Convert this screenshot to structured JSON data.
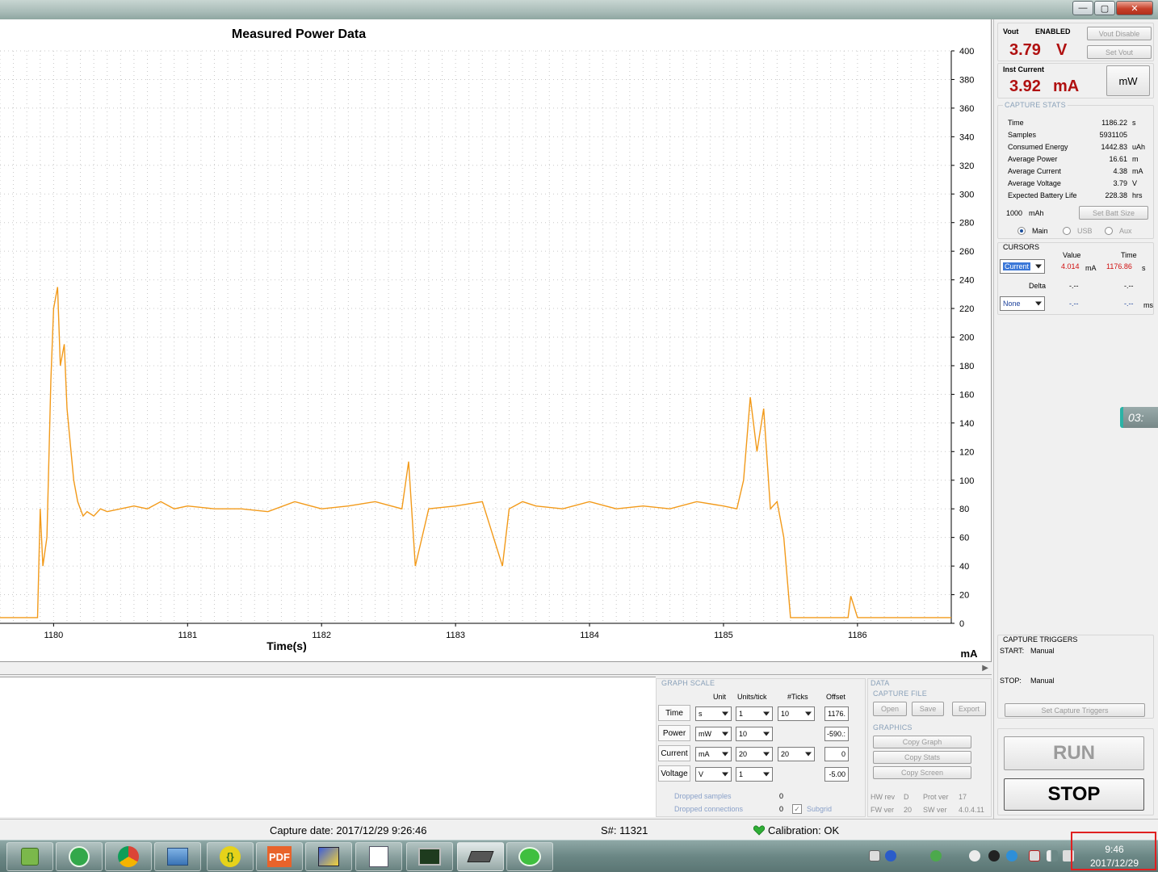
{
  "window": {
    "buttons": {
      "minimize": "—",
      "maximize": "▢",
      "close": "✕"
    }
  },
  "graph": {
    "title": "Measured Power Data",
    "xlabel": "Time(s)",
    "unit_label": "mA"
  },
  "chart_data": {
    "type": "line",
    "title": "Measured Power Data",
    "xlabel": "Time(s)",
    "ylabel": "mA",
    "xlim": [
      1179.6,
      1186.7
    ],
    "ylim": [
      0,
      400
    ],
    "x_ticks": [
      1180,
      1181,
      1182,
      1183,
      1184,
      1185,
      1186
    ],
    "y_ticks": [
      0,
      20,
      40,
      60,
      80,
      100,
      120,
      140,
      160,
      180,
      200,
      220,
      240,
      260,
      280,
      300,
      320,
      340,
      360,
      380,
      400
    ],
    "grid": true,
    "line_color": "#f29a1a",
    "series": [
      {
        "x": [
          1179.6,
          1179.88,
          1179.9,
          1179.92,
          1179.95,
          1179.98,
          1180.0,
          1180.03,
          1180.05,
          1180.08,
          1180.1,
          1180.12,
          1180.15,
          1180.18,
          1180.2,
          1180.22,
          1180.25,
          1180.3,
          1180.35,
          1180.4,
          1180.5,
          1180.6,
          1180.7,
          1180.8,
          1180.9,
          1181.0,
          1181.2,
          1181.4,
          1181.6,
          1181.8,
          1182.0,
          1182.2,
          1182.4,
          1182.6,
          1182.65,
          1182.7,
          1182.8,
          1183.0,
          1183.2,
          1183.35,
          1183.4,
          1183.5,
          1183.6,
          1183.8,
          1184.0,
          1184.2,
          1184.4,
          1184.6,
          1184.8,
          1185.0,
          1185.1,
          1185.15,
          1185.2,
          1185.25,
          1185.3,
          1185.35,
          1185.4,
          1185.45,
          1185.5,
          1185.6,
          1185.8,
          1185.93,
          1185.95,
          1186.0,
          1186.2,
          1186.5,
          1186.7
        ],
        "y": [
          4,
          4,
          80,
          40,
          60,
          170,
          220,
          235,
          180,
          195,
          150,
          130,
          100,
          85,
          80,
          75,
          78,
          75,
          80,
          78,
          80,
          82,
          80,
          85,
          80,
          82,
          80,
          80,
          78,
          85,
          80,
          82,
          85,
          80,
          113,
          40,
          80,
          82,
          85,
          40,
          80,
          85,
          82,
          80,
          85,
          80,
          82,
          80,
          85,
          82,
          80,
          100,
          158,
          120,
          150,
          80,
          85,
          60,
          4,
          4,
          4,
          4,
          19,
          4,
          4,
          4,
          4
        ]
      }
    ]
  },
  "right_panel": {
    "vout": {
      "label": "Vout",
      "status": "ENABLED",
      "value": "3.79",
      "unit": "V",
      "disable_btn": "Vout Disable",
      "set_btn": "Set Vout"
    },
    "inst_current": {
      "label": "Inst Current",
      "value": "3.92",
      "unit": "mA",
      "mode_btn": "mW"
    },
    "capture_stats": {
      "title": "CAPTURE STATS",
      "rows": [
        {
          "label": "Time",
          "value": "1186.22",
          "unit": "s"
        },
        {
          "label": "Samples",
          "value": "5931105",
          "unit": ""
        },
        {
          "label": "Consumed Energy",
          "value": "1442.83",
          "unit": "uAh"
        },
        {
          "label": "Average Power",
          "value": "16.61",
          "unit": "m"
        },
        {
          "label": "Average Current",
          "value": "4.38",
          "unit": "mA"
        },
        {
          "label": "Average Voltage",
          "value": "3.79",
          "unit": "V"
        },
        {
          "label": "Expected Battery Life",
          "value": "228.38",
          "unit": "hrs"
        }
      ],
      "battery_size": "1000",
      "battery_unit": "mAh",
      "set_batt_btn": "Set Batt Size",
      "radios": [
        {
          "label": "Main",
          "selected": true
        },
        {
          "label": "USB",
          "selected": false
        },
        {
          "label": "Aux",
          "selected": false
        }
      ]
    },
    "cursors": {
      "title": "CURSORS",
      "col_value": "Value",
      "col_time": "Time",
      "cursor1_select": "Current",
      "cursor1_value": "4.014",
      "cursor1_value_unit": "mA",
      "cursor1_time": "1176.86",
      "cursor1_time_unit": "s",
      "delta_label": "Delta",
      "delta_value": "-.--",
      "delta_time": "-.--",
      "cursor2_select": "None",
      "cursor2_value": "-.--",
      "cursor2_time": "-.--",
      "cursor2_time_unit": "ms"
    },
    "side_tab": "03:",
    "capture_triggers": {
      "title": "CAPTURE TRIGGERS",
      "start_label": "START:",
      "start_value": "Manual",
      "stop_label": "STOP:",
      "stop_value": "Manual",
      "set_btn": "Set Capture Triggers"
    },
    "run_btn": "RUN",
    "stop_btn": "STOP"
  },
  "graph_scale": {
    "title": "GRAPH SCALE",
    "headers": {
      "unit": "Unit",
      "units_tick": "Units/tick",
      "ticks": "#Ticks",
      "offset": "Offset"
    },
    "rows": [
      {
        "name": "Time",
        "unit": "s",
        "per_tick": "1",
        "ticks": "10",
        "offset": "1176."
      },
      {
        "name": "Power",
        "unit": "mW",
        "per_tick": "10",
        "ticks": "",
        "offset": "-590.:"
      },
      {
        "name": "Current",
        "unit": "mA",
        "per_tick": "20",
        "ticks": "20",
        "offset": "0"
      },
      {
        "name": "Voltage",
        "unit": "V",
        "per_tick": "1",
        "ticks": "",
        "offset": "-5.00"
      }
    ],
    "dropped_samples_label": "Dropped samples",
    "dropped_samples": "0",
    "dropped_connections_label": "Dropped connections",
    "dropped_connections": "0",
    "subgrid_label": "Subgrid"
  },
  "data_box": {
    "title": "DATA",
    "capture_file": "CAPTURE FILE",
    "open_btn": "Open",
    "save_btn": "Save",
    "export_btn": "Export",
    "graphics": "GRAPHICS",
    "copy_graph": "Copy Graph",
    "copy_stats": "Copy Stats",
    "copy_screen": "Copy Screen",
    "hw_rev_label": "HW rev",
    "hw_rev": "D",
    "prot_ver_label": "Prot ver",
    "prot_ver": "17",
    "fw_ver_label": "FW ver",
    "fw_ver": "20",
    "sw_ver_label": "SW ver",
    "sw_ver": "4.0.4.11"
  },
  "status_bar": {
    "capture_date": "Capture date: 2017/12/29 9:26:46",
    "serial": "S#: 11321",
    "calibration": "Calibration: OK"
  },
  "taskbar": {
    "apps": [
      "android-studio",
      "wifi-tool",
      "chrome",
      "control-panel",
      "bracket-editor",
      "pdf-reader",
      "network-tool",
      "chart-tool",
      "monitor-app",
      "power-monitor",
      "wechat"
    ],
    "pdf_label": "PDF",
    "clock_time": "9:46",
    "clock_date": "2017/12/29"
  },
  "colors": {
    "trace": "#f29a1a",
    "value_red": "#b01010",
    "grid": "#c8c8c8",
    "heart": "#2fae36"
  }
}
